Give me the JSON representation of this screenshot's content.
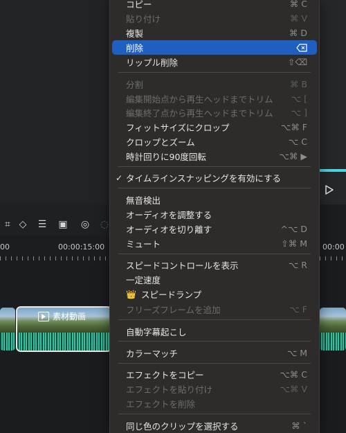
{
  "timeline": {
    "timecode_zero_partial": "00",
    "timecode_15": "00:00:15:00",
    "timecode_right_partial": "00:00",
    "clip_label": "素材動画"
  },
  "menu": {
    "copy": {
      "label": "コピー",
      "shortcut": "⌘ C"
    },
    "paste": {
      "label": "貼り付け",
      "shortcut": "⌘ V"
    },
    "duplicate": {
      "label": "複製",
      "shortcut": "⌘ D"
    },
    "delete": {
      "label": "削除"
    },
    "ripple_delete": {
      "label": "リップル削除",
      "shortcut": "⇧⌫"
    },
    "split": {
      "label": "分割",
      "shortcut": "⌘ B"
    },
    "trim_start": {
      "label": "編集開始点から再生ヘッドまでトリム",
      "shortcut": "⌥ ["
    },
    "trim_end": {
      "label": "編集終了点から再生ヘッドまでトリム",
      "shortcut": "⌥ ]"
    },
    "crop_fit": {
      "label": "フィットサイズにクロップ",
      "shortcut": "⌥⌘ F"
    },
    "crop_zoom": {
      "label": "クロップとズーム",
      "shortcut": "⌥ C"
    },
    "rotate": {
      "label": "時計回りに90度回転",
      "shortcut": "⌥⌘ ▶"
    },
    "snapping": {
      "label": "タイムラインスナッピングを有効にする",
      "checked": true
    },
    "silence_detect": {
      "label": "無音検出"
    },
    "adjust_audio": {
      "label": "オーディオを調整する"
    },
    "detach_audio": {
      "label": "オーディオを切り離す",
      "shortcut": "^⌥ D"
    },
    "mute": {
      "label": "ミュート",
      "shortcut": "⇧⌘ M"
    },
    "speed_control": {
      "label": "スピードコントロールを表示",
      "shortcut": "⌥ R"
    },
    "uniform_speed": {
      "label": "一定速度"
    },
    "speed_ramp": {
      "label": "スピードランプ"
    },
    "freeze_frame": {
      "label": "フリーズフレームを追加",
      "shortcut": "⌥ F"
    },
    "auto_caption": {
      "label": "自動字幕起こし"
    },
    "color_match": {
      "label": "カラーマッチ",
      "shortcut": "⌥ M"
    },
    "copy_effect": {
      "label": "エフェクトをコピー",
      "shortcut": "⌥⌘ C"
    },
    "paste_effect": {
      "label": "エフェクトを貼り付け",
      "shortcut": "⌥⌘ V"
    },
    "delete_effect": {
      "label": "エフェクトを削除"
    },
    "select_same_color": {
      "label": "同じ色のクリップを選択する",
      "shortcut": "⌘ `"
    }
  },
  "colors": {
    "highlight": "#1f5fbf",
    "accent": "#4fd3d9",
    "clip": "#2aa88c"
  },
  "icons": [
    "play-icon",
    "delete-key-icon",
    "crown-icon",
    "checkmark-icon"
  ]
}
